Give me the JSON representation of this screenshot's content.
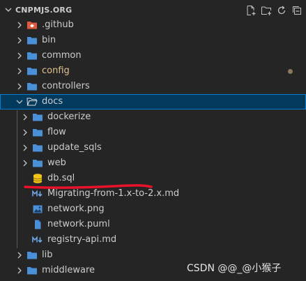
{
  "explorer": {
    "section_title": "CNPMJS.ORG",
    "actions": [
      "new-file-icon",
      "new-folder-icon",
      "refresh-icon",
      "collapse-all-icon"
    ]
  },
  "tree": [
    {
      "label": ".github",
      "type": "folder-special",
      "depth": 0,
      "expanded": false
    },
    {
      "label": "bin",
      "type": "folder",
      "depth": 0,
      "expanded": false
    },
    {
      "label": "common",
      "type": "folder",
      "depth": 0,
      "expanded": false
    },
    {
      "label": "config",
      "type": "folder",
      "depth": 0,
      "expanded": false,
      "modified": true
    },
    {
      "label": "controllers",
      "type": "folder",
      "depth": 0,
      "expanded": false
    },
    {
      "label": "docs",
      "type": "folder-open",
      "depth": 0,
      "expanded": true,
      "selected": true
    },
    {
      "label": "dockerize",
      "type": "folder",
      "depth": 1,
      "expanded": false
    },
    {
      "label": "flow",
      "type": "folder",
      "depth": 1,
      "expanded": false
    },
    {
      "label": "update_sqls",
      "type": "folder",
      "depth": 1,
      "expanded": false
    },
    {
      "label": "web",
      "type": "folder",
      "depth": 1,
      "expanded": false
    },
    {
      "label": "db.sql",
      "type": "database-file",
      "depth": 1
    },
    {
      "label": "Migrating-from-1.x-to-2.x.md",
      "type": "markdown-file",
      "depth": 1
    },
    {
      "label": "network.png",
      "type": "image-file",
      "depth": 1
    },
    {
      "label": "network.puml",
      "type": "file",
      "depth": 1
    },
    {
      "label": "registry-api.md",
      "type": "markdown-file",
      "depth": 1
    },
    {
      "label": "lib",
      "type": "folder",
      "depth": 0,
      "expanded": false
    },
    {
      "label": "middleware",
      "type": "folder",
      "depth": 0,
      "expanded": false
    }
  ],
  "watermark": "CSDN @@_@小猴子",
  "colors": {
    "folder": "#4a90d9",
    "selected_bg": "#04395e",
    "modified": "#e2c08d",
    "annotation": "#e8132a"
  }
}
